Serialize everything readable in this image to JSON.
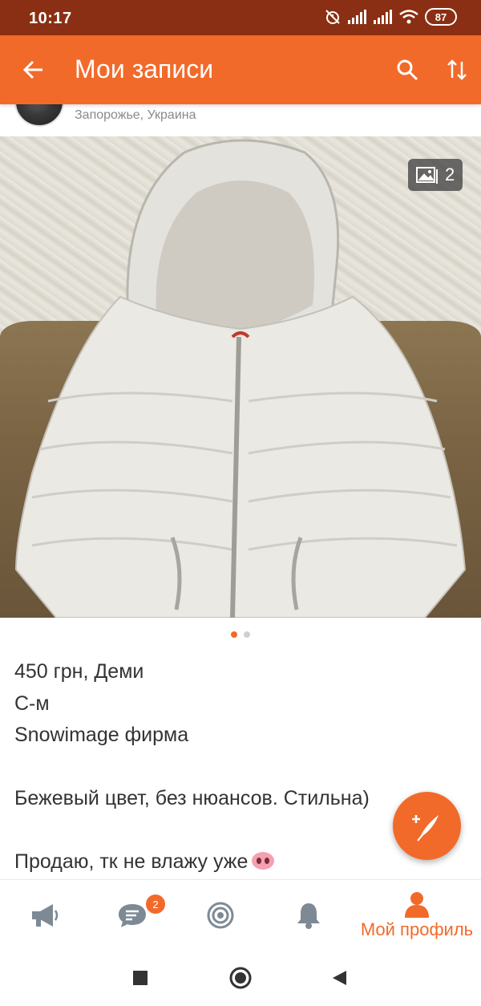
{
  "status_bar": {
    "time": "10:17",
    "battery": "87",
    "icons": [
      "alarm-off-icon",
      "signal-icon",
      "signal-icon",
      "wifi-icon",
      "battery-icon"
    ]
  },
  "app_bar": {
    "title": "Мои записи",
    "back_icon": "arrow-left-icon",
    "search_icon": "search-icon",
    "sort_icon": "sort-icon"
  },
  "author": {
    "location": "Запорожье, Украина"
  },
  "photo": {
    "count": "2",
    "count_icon": "gallery-icon",
    "dots_total": 2,
    "dots_active": 0
  },
  "post": {
    "lines": [
      "450 грн, Деми",
      "С-м",
      "Snowimage фирма",
      "",
      "Бежевый цвет, без нюансов. Стильна)",
      "",
      "Продаю, тк не влажу уже"
    ],
    "emoji": "pig-nose-emoji"
  },
  "fab": {
    "icon": "feather-plus-icon"
  },
  "bottom_nav": {
    "items": [
      {
        "icon": "megaphone-icon"
      },
      {
        "icon": "chat-icon",
        "badge": "2"
      },
      {
        "icon": "target-icon"
      },
      {
        "icon": "bell-icon"
      },
      {
        "icon": "person-icon",
        "label": "Мой профиль"
      }
    ]
  },
  "system_nav": {
    "buttons": [
      "recents-square-icon",
      "home-circle-icon",
      "back-triangle-icon"
    ]
  },
  "colors": {
    "brand": "#f26a2a",
    "status_bar": "#8a2f13"
  }
}
